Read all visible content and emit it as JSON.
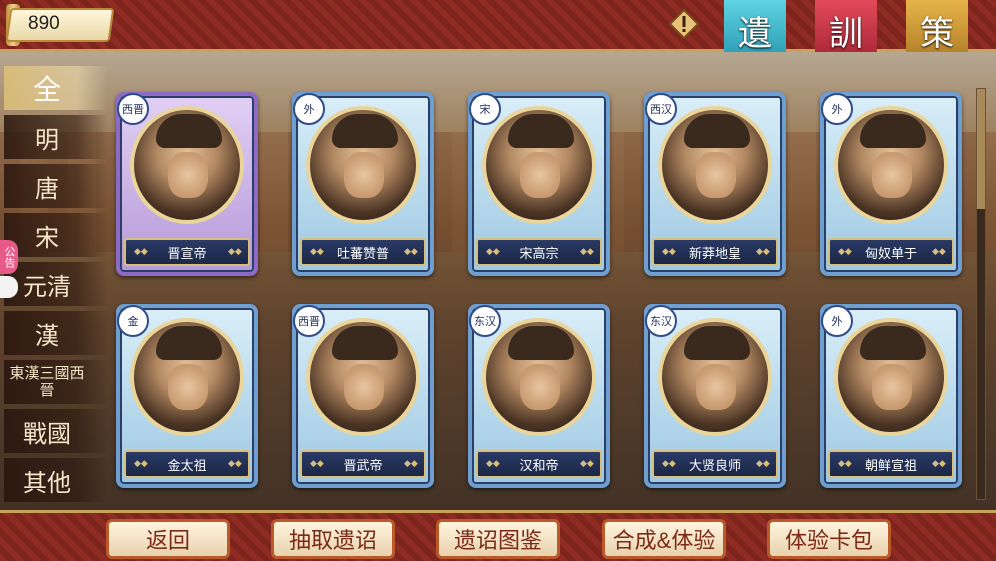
{
  "topbar": {
    "counter_value": "890",
    "alert_icon": "exclamation-icon",
    "banners": [
      "遺",
      "訓",
      "策"
    ]
  },
  "sidebar": {
    "items": [
      "全",
      "明",
      "唐",
      "宋",
      "元清",
      "漢",
      "東漢三國西晉",
      "戰國",
      "其他"
    ],
    "notice_label": "公告"
  },
  "cards": [
    {
      "dynasty": "西晋",
      "name": "晋宣帝"
    },
    {
      "dynasty": "外",
      "name": "吐蕃赞普"
    },
    {
      "dynasty": "宋",
      "name": "宋高宗"
    },
    {
      "dynasty": "西汉",
      "name": "新莽地皇"
    },
    {
      "dynasty": "外",
      "name": "匈奴单于"
    },
    {
      "dynasty": "金",
      "name": "金太祖"
    },
    {
      "dynasty": "西晋",
      "name": "晋武帝"
    },
    {
      "dynasty": "东汉",
      "name": "汉和帝"
    },
    {
      "dynasty": "东汉",
      "name": "大贤良师"
    },
    {
      "dynasty": "外",
      "name": "朝鲜宣祖"
    }
  ],
  "bottombar": {
    "buttons": [
      "返回",
      "抽取遗诏",
      "遗诏图鉴",
      "合成&体验",
      "体验卡包"
    ]
  },
  "colors": {
    "frame_red": "#8e2b22",
    "gold": "#c9a35a",
    "card_blue": "#6f9fd0",
    "card_purple": "#8d6ac6"
  }
}
